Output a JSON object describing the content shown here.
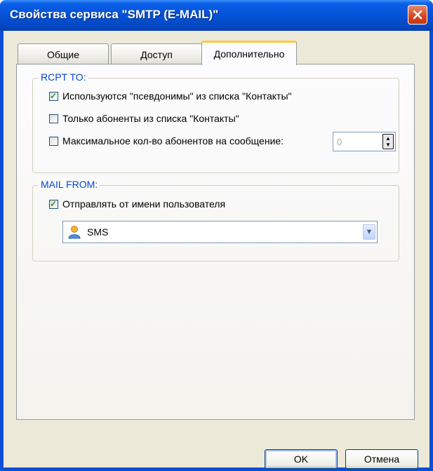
{
  "window": {
    "title": "Свойства сервиса \"SMTP (E-MAIL)\""
  },
  "tabs": [
    {
      "label": "Общие",
      "active": false
    },
    {
      "label": "Доступ",
      "active": false
    },
    {
      "label": "Дополнительно",
      "active": true
    }
  ],
  "rcpt_to": {
    "legend": "RCPT TO:",
    "use_aliases": {
      "label": "Используются  \"псевдонимы\" из списка \"Контакты\"",
      "checked": true
    },
    "only_contacts": {
      "label": "Только абоненты из списка \"Контакты\"",
      "checked": false
    },
    "max_recipients": {
      "label": "Максимальное кол-во абонентов на сообщение:",
      "checked": false,
      "value": "0"
    }
  },
  "mail_from": {
    "legend": "MAIL FROM:",
    "send_as_user": {
      "label": "Отправлять от имени пользователя",
      "checked": true
    },
    "user_select": {
      "value": "SMS",
      "icon": "user-icon"
    }
  },
  "buttons": {
    "ok": "OK",
    "cancel": "Отмена"
  }
}
